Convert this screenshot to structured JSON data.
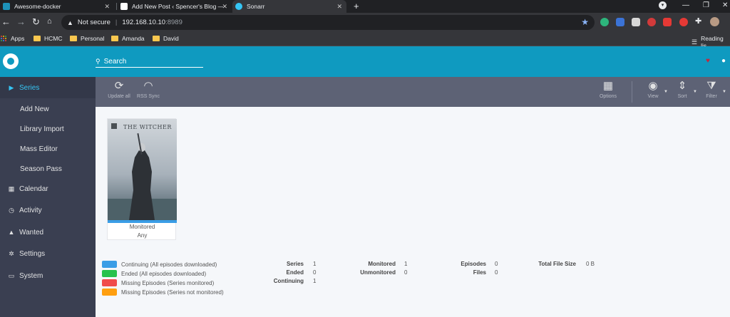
{
  "browser": {
    "tabs": [
      {
        "title": "Awesome-docker"
      },
      {
        "title": "Add New Post ‹ Spencer's Blog —"
      },
      {
        "title": "Sonarr"
      }
    ],
    "security_label": "Not secure",
    "url_host": "192.168.10.10",
    "url_port": ":8989",
    "reading_list": "Reading lis",
    "bookmarks": [
      {
        "label": "Apps"
      },
      {
        "label": "HCMC"
      },
      {
        "label": "Personal"
      },
      {
        "label": "Amanda"
      },
      {
        "label": "David"
      }
    ]
  },
  "header": {
    "search_placeholder": "Search"
  },
  "sidebar": {
    "items": [
      {
        "label": "Series",
        "icon": "play-icon"
      },
      {
        "label": "Add New"
      },
      {
        "label": "Library Import"
      },
      {
        "label": "Mass Editor"
      },
      {
        "label": "Season Pass"
      },
      {
        "label": "Calendar",
        "icon": "calendar-icon"
      },
      {
        "label": "Activity",
        "icon": "clock-icon"
      },
      {
        "label": "Wanted",
        "icon": "warning-icon"
      },
      {
        "label": "Settings",
        "icon": "cogs-icon"
      },
      {
        "label": "System",
        "icon": "laptop-icon"
      }
    ]
  },
  "toolbar": {
    "update_all": "Update all",
    "rss_sync": "RSS Sync",
    "options": "Options",
    "view": "View",
    "sort": "Sort",
    "filter": "Filter"
  },
  "series_card": {
    "poster_title": "THE WITCHER",
    "status": "Monitored",
    "quality": "Any"
  },
  "legend": [
    {
      "label": "Continuing (All episodes downloaded)",
      "color": "#3a9de6"
    },
    {
      "label": "Ended (All episodes downloaded)",
      "color": "#27c24c"
    },
    {
      "label": "Missing Episodes (Series monitored)",
      "color": "#f04b4b"
    },
    {
      "label": "Missing Episodes (Series not monitored)",
      "color": "#ff9f10"
    }
  ],
  "stats": {
    "series_label": "Series",
    "series": "1",
    "ended_label": "Ended",
    "ended": "0",
    "continuing_label": "Continuing",
    "continuing": "1",
    "monitored_label": "Monitored",
    "monitored": "1",
    "unmonitored_label": "Unmonitored",
    "unmonitored": "0",
    "episodes_label": "Episodes",
    "episodes": "0",
    "files_label": "Files",
    "files": "0",
    "total_size_label": "Total File Size",
    "total_size": "0 B"
  },
  "colors": {
    "header": "#0f9ac0",
    "sidebar": "#3a3f51",
    "active_link": "#35c5f4",
    "toolbar": "#5d6275"
  }
}
